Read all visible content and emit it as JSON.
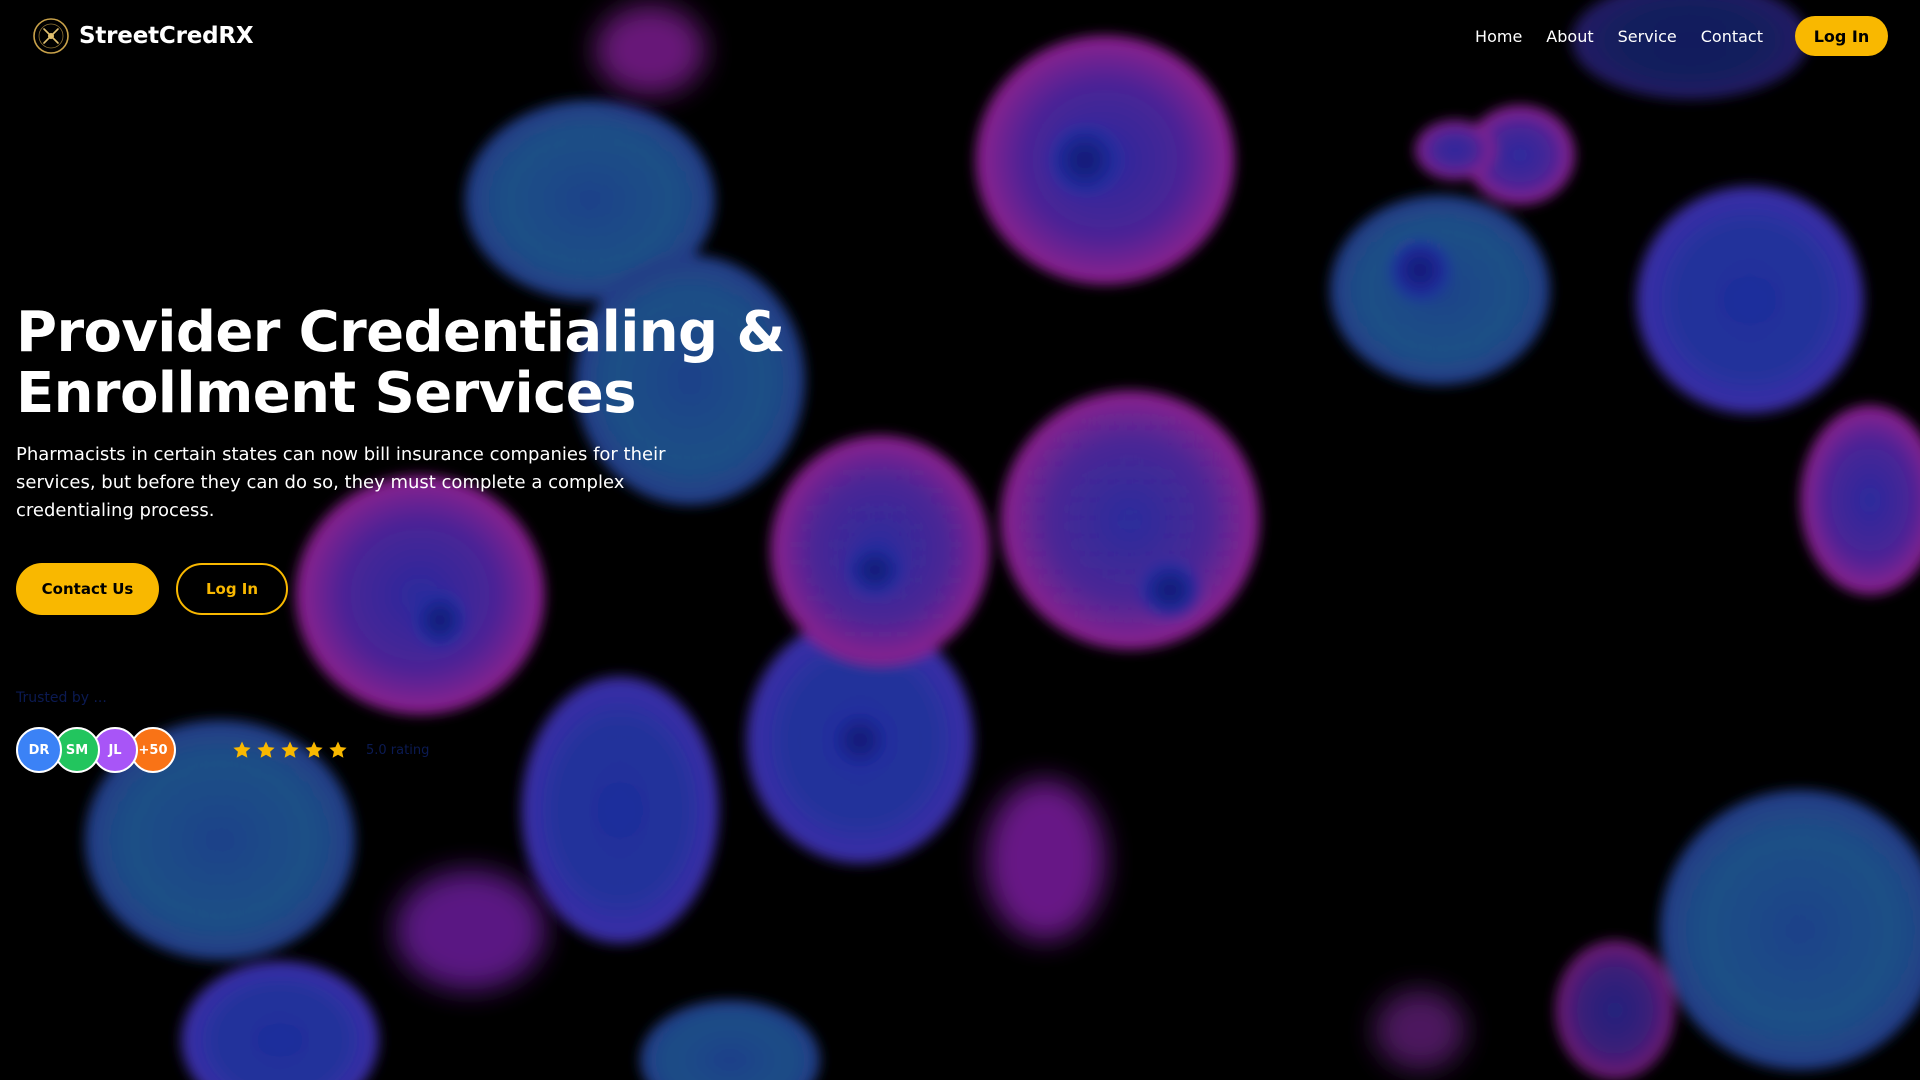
{
  "header": {
    "brand": "StreetCredRX",
    "nav": {
      "home": "Home",
      "about": "About",
      "service": "Service",
      "contact": "Contact"
    },
    "login_label": "Log In"
  },
  "hero": {
    "title_line1": "Provider Credentialing &",
    "title_line2": "Enrollment Services",
    "description": "Pharmacists in certain states can now bill insurance companies for their services, but before they can do so, they must complete a complex credentialing process.",
    "contact_button": "Contact Us",
    "login_button": "Log In"
  },
  "social_proof": {
    "trusted_label": "Trusted by ...",
    "avatars": [
      {
        "initials": "DR",
        "color": "#3b82f6"
      },
      {
        "initials": "SM",
        "color": "#22c55e"
      },
      {
        "initials": "JL",
        "color": "#a855f7"
      },
      {
        "initials": "+50",
        "color": "#f97316"
      }
    ],
    "rating_stars": 5,
    "reviews_text": "5.0 rating"
  },
  "colors": {
    "accent": "#f9b800",
    "background": "#000000"
  },
  "icons": {
    "logo": "pill-emblem-icon",
    "star": "star-icon"
  }
}
